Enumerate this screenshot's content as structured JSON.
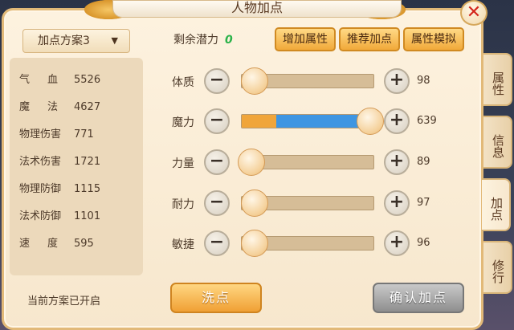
{
  "window": {
    "title": "人物加点",
    "close_label": "✕"
  },
  "scheme": {
    "selected": "加点方案3",
    "status": "当前方案已开启"
  },
  "stats": [
    {
      "label": "气血",
      "value": "5526",
      "spread": true
    },
    {
      "label": "魔法",
      "value": "4627",
      "spread": true
    },
    {
      "label": "物理伤害",
      "value": "771",
      "spread": false
    },
    {
      "label": "法术伤害",
      "value": "1721",
      "spread": false
    },
    {
      "label": "物理防御",
      "value": "1115",
      "spread": false
    },
    {
      "label": "法术防御",
      "value": "1101",
      "spread": false
    },
    {
      "label": "速度",
      "value": "595",
      "spread": true
    }
  ],
  "potential": {
    "label": "剩余潜力",
    "value": "0"
  },
  "toolbar": {
    "add": "增加属性",
    "recommend": "推荐加点",
    "simulate": "属性模拟"
  },
  "attributes": [
    {
      "label": "体质",
      "value": "98",
      "base_fraction": 0.0,
      "add_fraction": 0.0,
      "knob_fraction": 0.1
    },
    {
      "label": "魔力",
      "value": "639",
      "base_fraction": 0.26,
      "add_fraction": 0.74,
      "knob_fraction": 0.97
    },
    {
      "label": "力量",
      "value": "89",
      "base_fraction": 0.04,
      "add_fraction": 0.0,
      "knob_fraction": 0.08
    },
    {
      "label": "耐力",
      "value": "97",
      "base_fraction": 0.06,
      "add_fraction": 0.0,
      "knob_fraction": 0.1
    },
    {
      "label": "敏捷",
      "value": "96",
      "base_fraction": 0.06,
      "add_fraction": 0.0,
      "knob_fraction": 0.1
    }
  ],
  "buttons": {
    "minus": "−",
    "plus": "+",
    "wash": "洗点",
    "confirm": "确认加点"
  },
  "tabs": [
    {
      "label": "属性",
      "active": false
    },
    {
      "label": "信息",
      "active": false
    },
    {
      "label": "加点",
      "active": true
    },
    {
      "label": "修行",
      "active": false
    }
  ],
  "colors": {
    "base_fill": "#f0a53a",
    "add_fill": "#3e95e2",
    "potential_value": "#2bb24a",
    "close_x": "#d3251b"
  }
}
